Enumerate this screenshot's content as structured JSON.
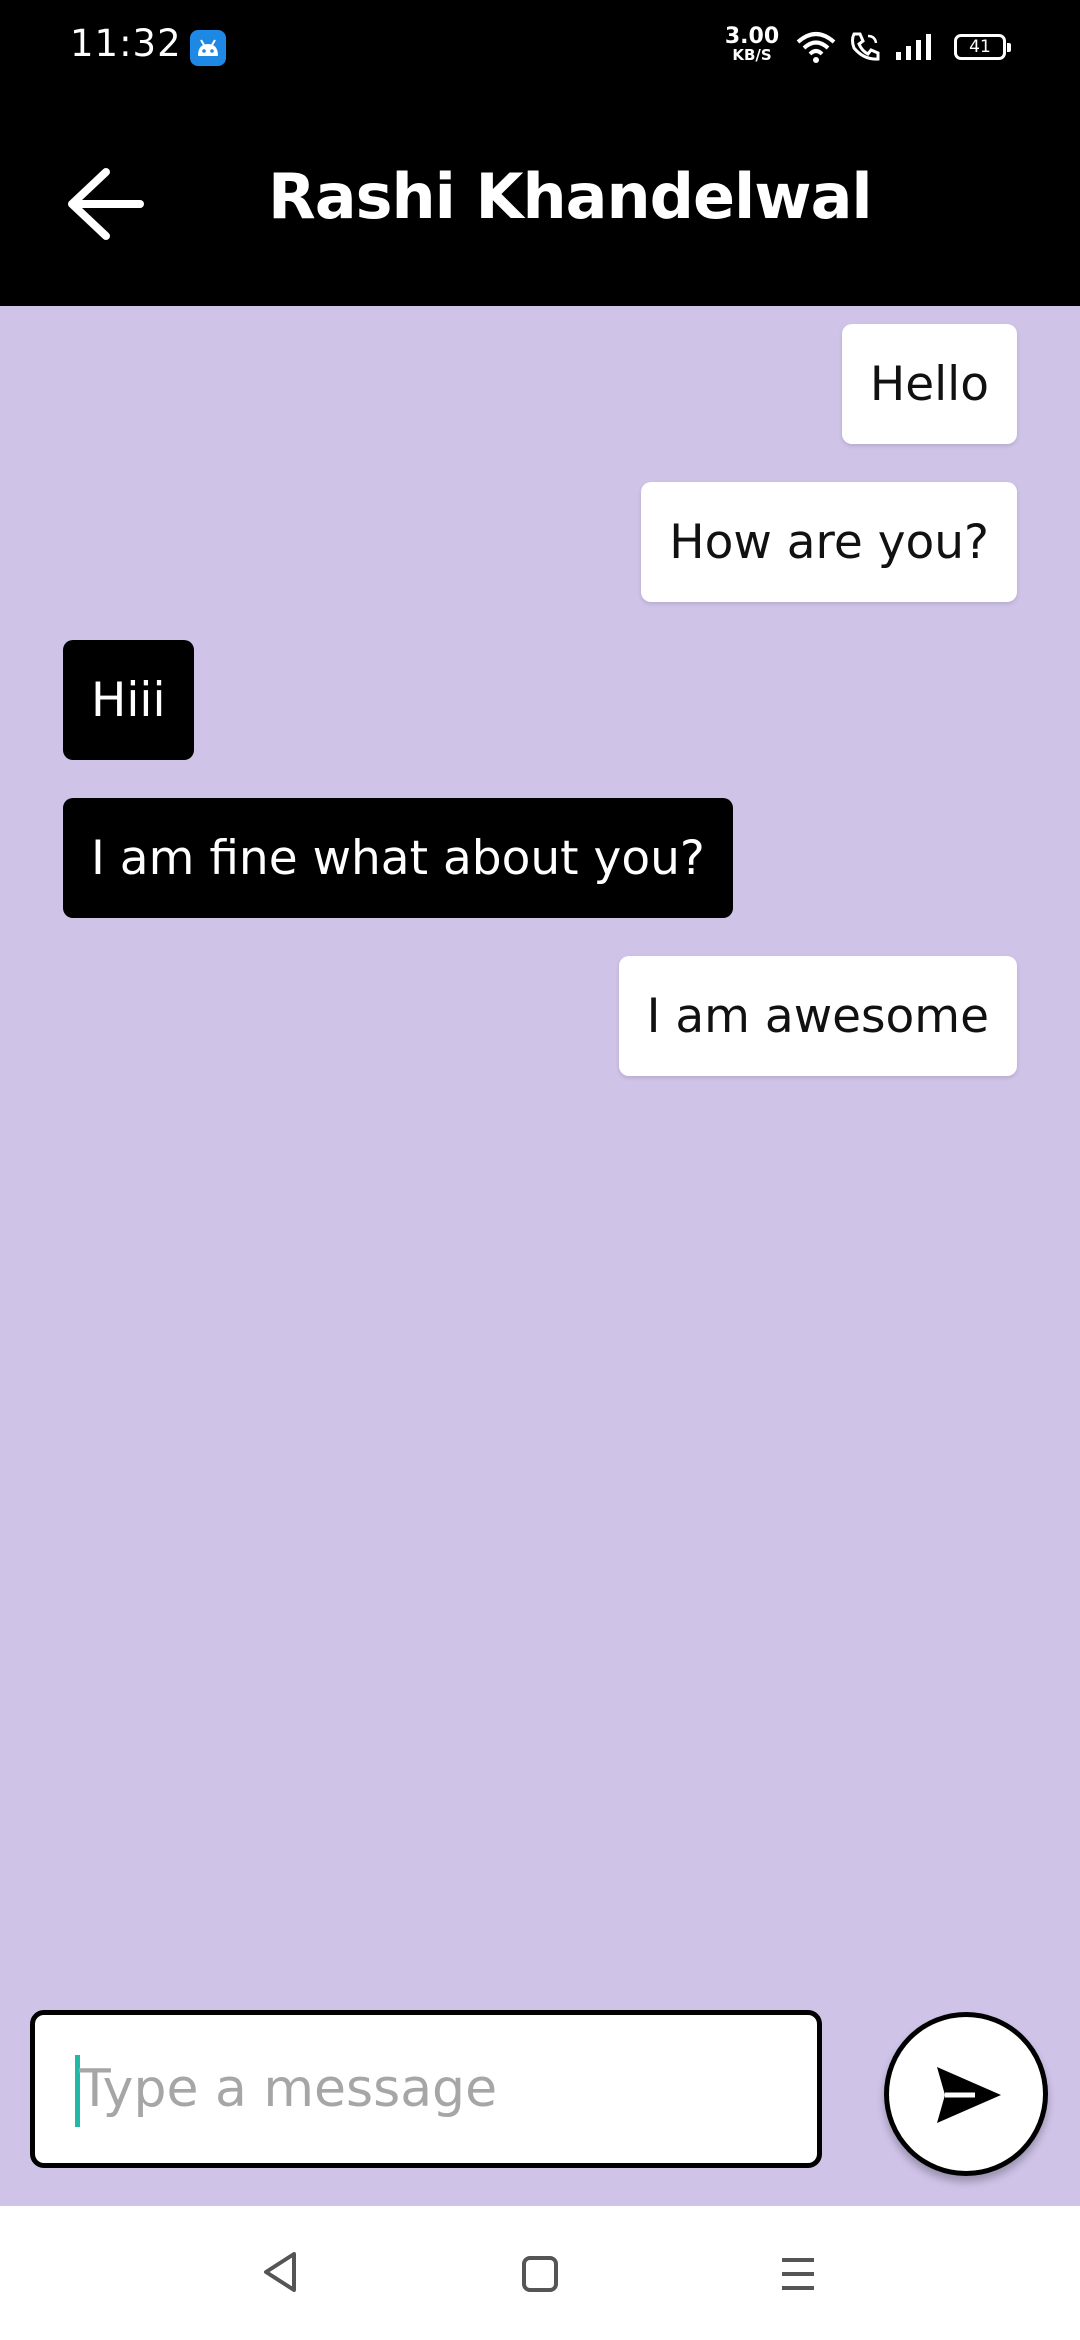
{
  "status_bar": {
    "time": "11:32",
    "net_speed_value": "3.00",
    "net_speed_unit": "KB/S",
    "battery": "41"
  },
  "app_bar": {
    "title": "Rashi Khandelwal"
  },
  "messages": [
    {
      "text": "Hello",
      "direction": "sent"
    },
    {
      "text": "How are you?",
      "direction": "sent"
    },
    {
      "text": "Hiii",
      "direction": "received"
    },
    {
      "text": "I am fine what about you?",
      "direction": "received"
    },
    {
      "text": "I am awesome",
      "direction": "sent"
    }
  ],
  "composer": {
    "placeholder": "Type a message",
    "value": ""
  },
  "colors": {
    "chat_background": "#cfc3e8",
    "header_background": "#000000",
    "sent_bubble": "#ffffff",
    "received_bubble": "#000000",
    "caret": "#22b8a8"
  },
  "icons": {
    "back": "arrow-left-icon",
    "send": "send-icon",
    "nav_back": "triangle-back-icon",
    "nav_home": "square-home-icon",
    "nav_recents": "menu-lines-icon"
  }
}
